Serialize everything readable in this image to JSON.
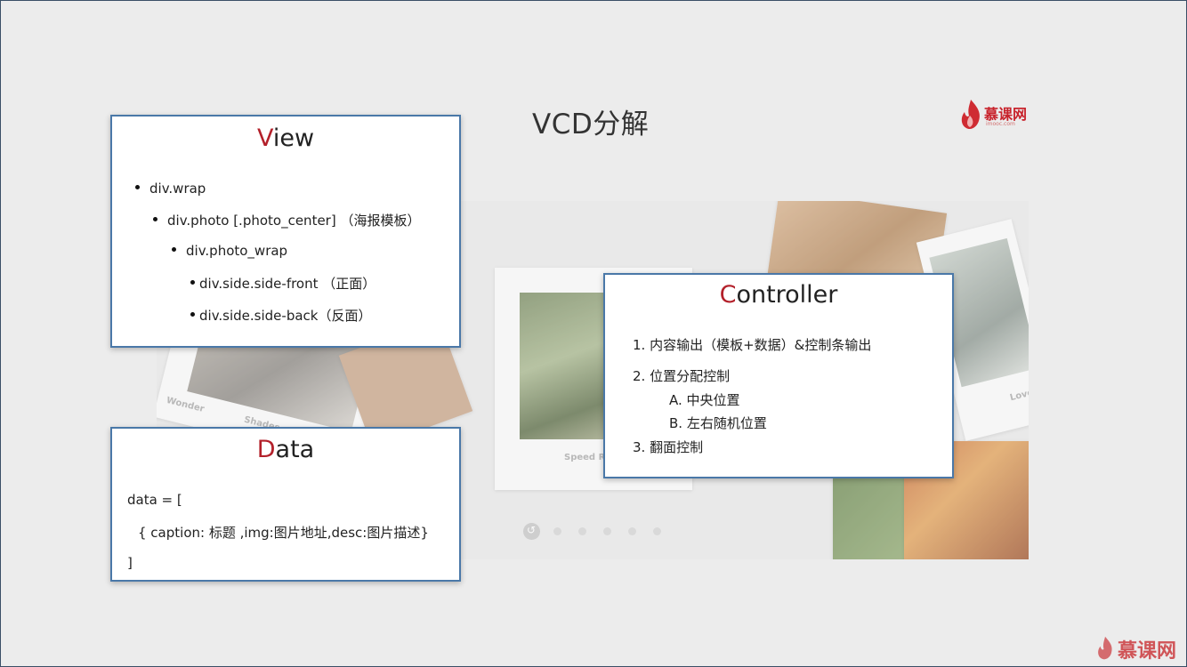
{
  "slide": {
    "title": "VCD分解",
    "brand": {
      "name": "慕课网",
      "sub": "imooc.com"
    },
    "watermark": "慕课网"
  },
  "view": {
    "title_first": "V",
    "title_rest": "iew",
    "items": [
      "div.wrap",
      "div.photo [.photo_center] （海报模板）",
      "div.photo_wrap",
      "div.side.side-front （正面）",
      "div.side.side-back（反面）"
    ]
  },
  "data": {
    "title_first": "D",
    "title_rest": "ata",
    "lines": [
      "data = [",
      "{ caption: 标题 ,img:图片地址,desc:图片描述}",
      "]"
    ]
  },
  "controller": {
    "title_first": "C",
    "title_rest": "ontroller",
    "lines": [
      "1. 内容输出（模板+数据）&控制条输出",
      "2. 位置分配控制",
      "A.  中央位置",
      "B.  左右随机位置",
      "3. 翻面控制"
    ]
  },
  "gallery": {
    "captions": [
      "Wonder",
      "Shades of blue",
      "Speed R",
      "Love"
    ],
    "dot_count": 6,
    "active_dot": 0
  },
  "colors": {
    "accent": "#b3202a",
    "panel_border": "#4a78a8",
    "brand": "#c8232c"
  }
}
